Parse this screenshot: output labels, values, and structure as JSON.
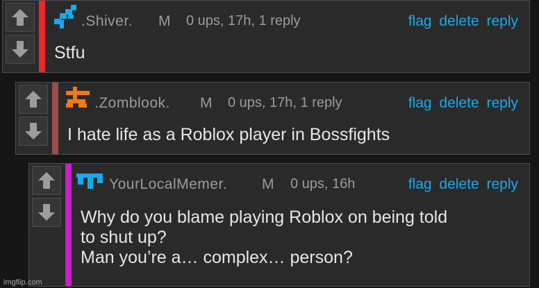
{
  "comments": [
    {
      "username": ".Shiver.",
      "gender": "M",
      "meta": "0 ups, 17h, 1 reply",
      "actions": [
        "flag",
        "delete",
        "reply"
      ],
      "text": [
        "Stfu"
      ],
      "stripe_color": "#f0262b",
      "avatar_color": "#18a9ea"
    },
    {
      "username": ".Zomblook.",
      "gender": "M",
      "meta": "0 ups, 17h, 1 reply",
      "actions": [
        "flag",
        "delete",
        "reply"
      ],
      "text": [
        "I hate life as a Roblox player in Bossfights"
      ],
      "stripe_color": "#9b4b4b",
      "avatar_color": "#f07a17"
    },
    {
      "username": "YourLocalMemer.",
      "gender": "M",
      "meta": "0 ups, 16h",
      "actions": [
        "flag",
        "delete",
        "reply"
      ],
      "text": [
        "Why do you blame playing Roblox on being told",
        "to shut up?",
        "Man you’re a… complex… person?"
      ],
      "stripe_color": "#c81fc8",
      "avatar_color": "#18a9ea"
    }
  ],
  "icons": {
    "upvote": "arrow-up-icon",
    "downvote": "arrow-down-icon"
  },
  "watermark": "imgflip.com"
}
